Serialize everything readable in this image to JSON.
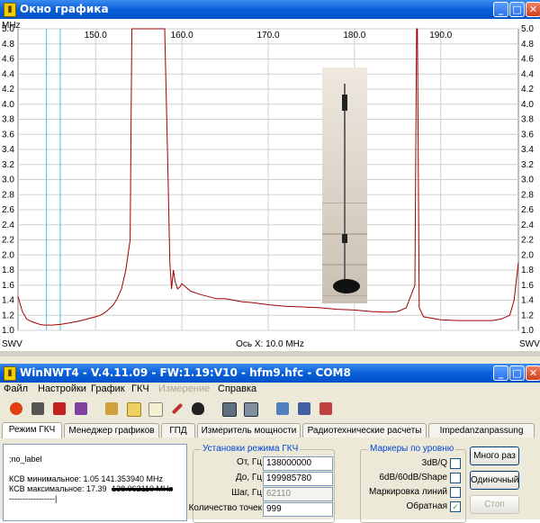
{
  "chart_window": {
    "title": "Окно графика",
    "icon": "chart-window-icon",
    "controls": [
      "minimize",
      "maximize",
      "close"
    ]
  },
  "chart_data": {
    "type": "line",
    "xlabel": "Ось X: 10.0 MHz",
    "x_unit": "MHz",
    "y_unit_left": "SWV",
    "y_unit_right": "SWV",
    "xlim": [
      141.0,
      199.0
    ],
    "ylim": [
      1.0,
      5.0
    ],
    "x_ticks": [
      150.0,
      160.0,
      170.0,
      180.0,
      190.0
    ],
    "x_tick_labels": [
      "150.0",
      "160.0",
      "170.0",
      "180.0",
      "190.0"
    ],
    "y_ticks": [
      1.0,
      1.2,
      1.4,
      1.6,
      1.8,
      2.0,
      2.2,
      2.4,
      2.6,
      2.8,
      3.0,
      3.2,
      3.4,
      3.6,
      3.8,
      4.0,
      4.2,
      4.4,
      4.6,
      4.8,
      5.0
    ],
    "y_tick_labels": [
      "1.0",
      "1.2",
      "1.4",
      "1.6",
      "1.8",
      "2.0",
      "2.2",
      "2.4",
      "2.6",
      "2.8",
      "3.0",
      "3.2",
      "3.4",
      "3.6",
      "3.8",
      "4.0",
      "4.2",
      "4.4",
      "4.6",
      "4.8",
      "5.0"
    ],
    "grid": true,
    "markers_x": [
      144.3,
      145.9
    ],
    "series": [
      {
        "color": "#a00000",
        "x": [
          141.0,
          141.5,
          142.0,
          142.5,
          143.0,
          143.5,
          144.0,
          145.0,
          146.0,
          147.0,
          148.0,
          149.0,
          150.0,
          150.5,
          151.0,
          151.5,
          152.0,
          152.5,
          153.0,
          153.5,
          154.0,
          154.2,
          154.3,
          154.4,
          155.0,
          155.5,
          156.0,
          156.5,
          157.0,
          157.5,
          158.0,
          158.4,
          158.6,
          158.8,
          159.0,
          159.2,
          159.5,
          159.8,
          160.0,
          161.0,
          162.0,
          163.0,
          164.0,
          165.0,
          166.0,
          167.0,
          168.0,
          170.0,
          172.0,
          174.0,
          176.0,
          178.0,
          180.0,
          182.0,
          184.0,
          185.0,
          186.0,
          187.0,
          187.2,
          187.3,
          187.5,
          188.0,
          190.0,
          192.0,
          194.0,
          196.0,
          197.0,
          198.0,
          198.5,
          199.0
        ],
        "y": [
          1.45,
          1.25,
          1.15,
          1.12,
          1.1,
          1.08,
          1.07,
          1.07,
          1.08,
          1.1,
          1.12,
          1.15,
          1.18,
          1.2,
          1.23,
          1.28,
          1.33,
          1.42,
          1.55,
          1.8,
          2.2,
          5.0,
          5.0,
          5.0,
          5.0,
          5.0,
          5.0,
          5.0,
          5.0,
          5.0,
          5.0,
          3.0,
          1.9,
          1.55,
          1.8,
          1.65,
          1.55,
          1.58,
          1.62,
          1.52,
          1.48,
          1.45,
          1.42,
          1.42,
          1.4,
          1.38,
          1.37,
          1.34,
          1.32,
          1.31,
          1.3,
          1.28,
          1.27,
          1.25,
          1.24,
          1.25,
          1.3,
          1.6,
          5.0,
          5.0,
          1.3,
          1.18,
          1.14,
          1.13,
          1.13,
          1.13,
          1.15,
          1.2,
          1.4,
          1.9
        ]
      }
    ]
  },
  "main_window": {
    "title": "WinNWT4 - V.4.11.09 - FW:1.19:V10 - hfm9.hfc - COM8",
    "icon": "winnwt-app-icon"
  },
  "menu": [
    "Файл",
    "Настройки",
    "График",
    "ГКЧ",
    "Измерение",
    "Справка"
  ],
  "toolbar_icons": [
    "power-icon",
    "print-icon",
    "printer-color-icon",
    "screenshot-icon",
    "tools-icon",
    "table-icon",
    "document-icon",
    "pencil-icon",
    "penguin-icon",
    "calibrate-icon",
    "calibrate-alt-icon",
    "open-file-icon",
    "save-icon",
    "delete-icon"
  ],
  "tabs": [
    "Режим ГКЧ",
    "Менеджер графиков",
    "ГПД",
    "Измеритель мощности",
    "Радиотехнические расчеты",
    "Impedanzanpassung"
  ],
  "log": {
    "line1": ";no_label",
    "line2": "КСВ минимальное: 1.05  141.353940 MHz",
    "line3_prefix": "КСВ максимальное: 17.39",
    "line3_struck": "138.062110 MHz",
    "line4": "-----------------|"
  },
  "sweep_settings": {
    "title": "Установки режима ГКЧ",
    "from_label": "От, Гц",
    "from_value": "138000000",
    "to_label": "До, Гц",
    "to_value": "199985780",
    "step_label": "Шаг, Гц",
    "step_value": "62110",
    "points_label": "Количество точек",
    "points_value": "999"
  },
  "markers": {
    "title": "Маркеры по уровню",
    "item1": "3dB/Q",
    "item2": "6dB/60dB/Shape",
    "item3": "Маркировка линий",
    "item4": "Обратная",
    "item4_checked": "✓"
  },
  "buttons": {
    "multi": "Много раз",
    "single": "Одиночный",
    "stop": "Стоп"
  }
}
